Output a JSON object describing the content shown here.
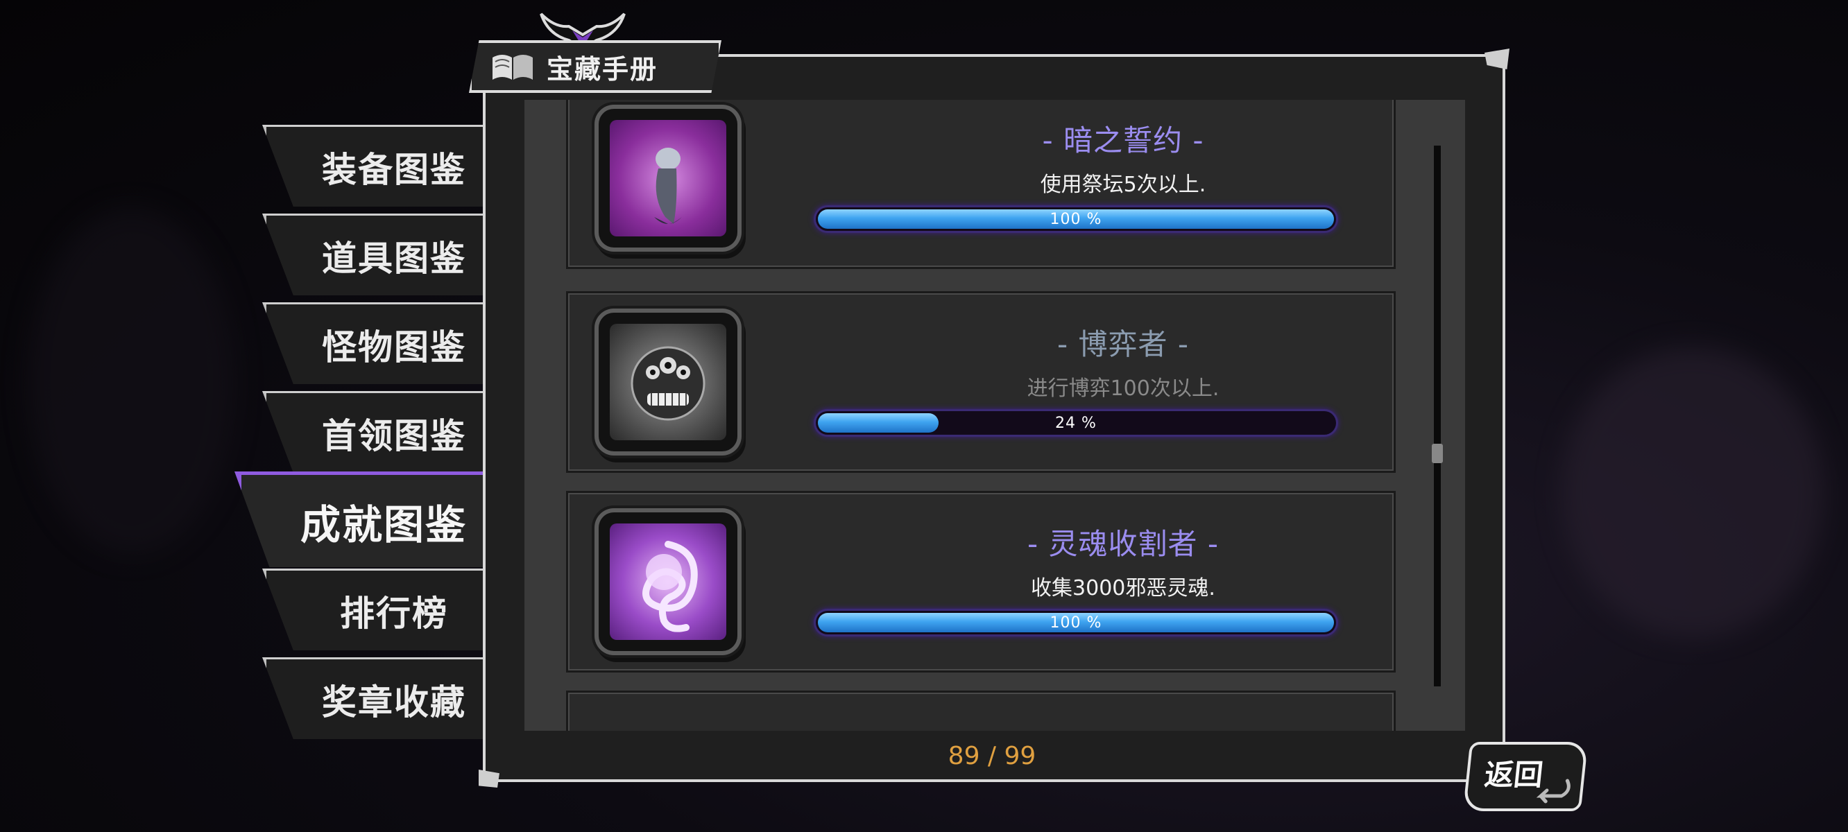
{
  "header": {
    "title": "宝藏手册",
    "book_icon": "open-book-icon"
  },
  "sidebar": {
    "items": [
      {
        "label": "装备图鉴",
        "active": false
      },
      {
        "label": "道具图鉴",
        "active": false
      },
      {
        "label": "怪物图鉴",
        "active": false
      },
      {
        "label": "首领图鉴",
        "active": false
      },
      {
        "label": "成就图鉴",
        "active": true
      },
      {
        "label": "排行榜",
        "active": false
      },
      {
        "label": "奖章收藏",
        "active": false
      }
    ]
  },
  "achievements": [
    {
      "title": "- 暗之誓约 -",
      "description": "使用祭坛5次以上.",
      "progress_label": "100 %",
      "progress": 1.0,
      "completed": true,
      "icon": "dark-oath-icon"
    },
    {
      "title": "- 博弈者 -",
      "description": "进行博弈100次以上.",
      "progress_label": "24 %",
      "progress": 0.24,
      "completed": false,
      "icon": "gambler-monster-icon"
    },
    {
      "title": "- 灵魂收割者 -",
      "description": "收集3000邪恶灵魂.",
      "progress_label": "100 %",
      "progress": 1.0,
      "completed": true,
      "icon": "soul-reaper-icon"
    }
  ],
  "counter": "89 / 99",
  "back_button": {
    "label": "返回"
  },
  "colors": {
    "active_tab_accent": "#8f5be0",
    "completed_title": "#9b8df0",
    "incomplete_title": "#8b9cb0",
    "completed_desc": "#f2f2f2",
    "incomplete_desc": "#8a8a8a",
    "counter": "#e0a040"
  }
}
